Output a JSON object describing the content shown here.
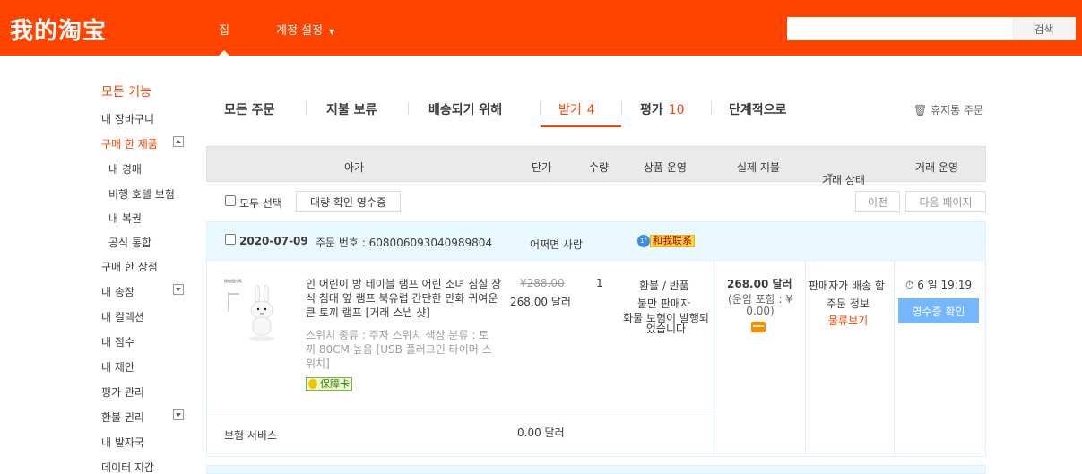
{
  "header": {
    "logo": "我的淘宝",
    "nav_home": "집",
    "nav_settings": "계정 설정",
    "search_placeholder": "",
    "search_button": "검색"
  },
  "sidebar": {
    "title": "모든 기능",
    "items": [
      {
        "label": "내 장바구니"
      },
      {
        "label": "구매 한 제품"
      },
      {
        "label": "내 경매"
      },
      {
        "label": "비행 호텔 보험"
      },
      {
        "label": "내 복권"
      },
      {
        "label": "공식 통합"
      },
      {
        "label": "구매 한 상점"
      },
      {
        "label": "내 송장"
      },
      {
        "label": "내 컬렉션"
      },
      {
        "label": "내 점수"
      },
      {
        "label": "내 제안"
      },
      {
        "label": "평가 관리"
      },
      {
        "label": "환불 권리"
      },
      {
        "label": "내 발자국"
      },
      {
        "label": "데이터 지갑"
      }
    ]
  },
  "tabs": [
    {
      "label": "모든 주문",
      "count": ""
    },
    {
      "label": "지불 보류",
      "count": ""
    },
    {
      "label": "배송되기 위해",
      "count": ""
    },
    {
      "label": "받기",
      "count": "4"
    },
    {
      "label": "평가",
      "count": "10"
    },
    {
      "label": "단계적으로",
      "count": ""
    }
  ],
  "recycle_bin": "휴지통 주문",
  "columns": [
    "아가",
    "단가",
    "수량",
    "상품 운영",
    "실제 지불",
    "거래 상태",
    "거래 운영"
  ],
  "toolbar": {
    "select_all": "모두 선택",
    "bulk_confirm": "대량 확인 영수증",
    "prev": "이전",
    "next": "다음 페이지"
  },
  "order": {
    "date": "2020-07-09",
    "order_no_label": "주문 번호 : 608006093040989804",
    "seller": "어쩌면 사랑",
    "contact": "和我联系",
    "product_title": "인 어린이 방 테이블 램프 어린 소녀 침실 장식 침대 옆 램프 북유럽 간단한 만화 귀여운 큰 토끼 램프 [거래 스냅 샷]",
    "product_specs": "스위치 종류 : 주자 스위치   색상 분류 : 토끼 80CM 높음 [USB 플러그인 타이머 스위치]",
    "guarantee": "保障卡",
    "original_price": "¥288.00",
    "price": "268.00 달러",
    "quantity": "1",
    "op_refund": "환불 / 반품",
    "op_complain": "불만 판매자",
    "op_insurance": "화물 보험이 발행되었습니다",
    "paid": "268.00 달러",
    "shipping_note": "(운임 포함 : ¥ 0.00)",
    "status": "판매자가 배송 함",
    "order_info": "주문 정보",
    "logistics": "물류보기",
    "countdown": "6 일 19:19",
    "confirm_button": "영수증 확인",
    "insurance_label": "보험 서비스",
    "insurance_price": "0.00 달러"
  },
  "colors": {
    "brand": "#ff4400",
    "header_bg": "#ff4400",
    "accent_blue": "#74b6ff",
    "order_head_bg": "#eaf8ff"
  }
}
